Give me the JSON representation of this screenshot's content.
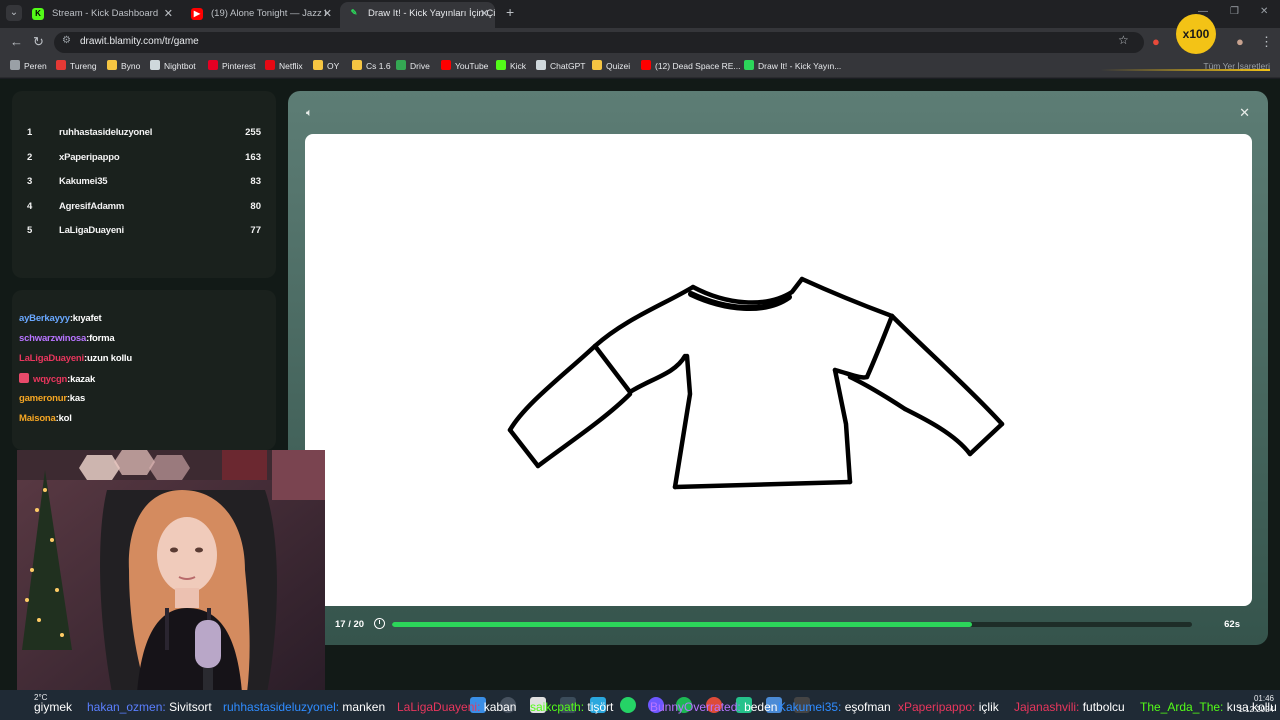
{
  "browser": {
    "tabs": [
      {
        "title": "Stream - Kick Dashboard",
        "icon": "kick-icon",
        "color": "#53fc18"
      },
      {
        "title": "(19) Alone Tonight — Jazz l",
        "icon": "youtube-icon",
        "color": "#ff0000"
      },
      {
        "title": "Draw It! - Kick Yayınları İçin Çiz",
        "icon": "drawit-icon",
        "color": "#2cd65a"
      }
    ],
    "url": "drawit.blamity.com/tr/game",
    "extension_badge": "x100",
    "bookmarks": [
      {
        "label": "Peren",
        "color": "#9aa0a6"
      },
      {
        "label": "Tureng",
        "color": "#e53935"
      },
      {
        "label": "Byno",
        "color": "#f5c542"
      },
      {
        "label": "Nightbot",
        "color": "#cfd8dc"
      },
      {
        "label": "Pinterest",
        "color": "#e60023"
      },
      {
        "label": "Netflix",
        "color": "#e50914"
      },
      {
        "label": "OY",
        "color": "#f5c542"
      },
      {
        "label": "Cs 1.6",
        "color": "#f5c542"
      },
      {
        "label": "Drive",
        "color": "#34a853"
      },
      {
        "label": "YouTube",
        "color": "#ff0000"
      },
      {
        "label": "Kick",
        "color": "#53fc18"
      },
      {
        "label": "ChatGPT",
        "color": "#cfd8dc"
      },
      {
        "label": "Quizei",
        "color": "#f5c542"
      },
      {
        "label": "(12) Dead Space RE...",
        "color": "#ff0000"
      },
      {
        "label": "Draw It! - Kick Yayın...",
        "color": "#2cd65a"
      }
    ],
    "bookmarks_all": "Tüm Yer İşaretleri"
  },
  "leaderboard": [
    {
      "rank": "1",
      "name": "ruhhastasideluzyonel",
      "score": "255"
    },
    {
      "rank": "2",
      "name": "xPaperipappo",
      "score": "163"
    },
    {
      "rank": "3",
      "name": "Kakumei35",
      "score": "83"
    },
    {
      "rank": "4",
      "name": "AgresifAdamm",
      "score": "80"
    },
    {
      "rank": "5",
      "name": "LaLigaDuayeni",
      "score": "77"
    }
  ],
  "chat": [
    {
      "user": "ayBerkayyy",
      "msg": "kıyafet",
      "color": "#6aa8ff",
      "badge": false
    },
    {
      "user": "schwarzwinosa",
      "msg": "forma",
      "color": "#b774ff",
      "badge": false
    },
    {
      "user": "LaLigaDuayeni",
      "msg": "uzun kollu",
      "color": "#e8365d",
      "badge": false
    },
    {
      "user": "wqycgn",
      "msg": "kazak",
      "color": "#e8365d",
      "badge": true
    },
    {
      "user": "gameronur",
      "msg": "kas",
      "color": "#f5a623",
      "badge": false
    },
    {
      "user": "Maisona",
      "msg": "kol",
      "color": "#f5a623",
      "badge": false
    }
  ],
  "game": {
    "round": "17 / 20",
    "time_left": "62s",
    "progress": 0.725
  },
  "ticker": [
    {
      "user": "",
      "msg": "giymek",
      "color": "#5a7fff"
    },
    {
      "user": "hakan_ozmen:",
      "msg": "Sivitsort",
      "color": "#5a7fff"
    },
    {
      "user": "ruhhastasideluzyonel:",
      "msg": "manken",
      "color": "#2f8cff"
    },
    {
      "user": "LaLigaDuayeni:",
      "msg": "kaban",
      "color": "#e8365d"
    },
    {
      "user": "saikcpath:",
      "msg": "tişört",
      "color": "#53fc18"
    },
    {
      "user": "BunnyOverrated:",
      "msg": "beden",
      "color": "#b774ff"
    },
    {
      "user": "Kakumei35:",
      "msg": "eşofman",
      "color": "#2f8cff"
    },
    {
      "user": "xPaperipappo:",
      "msg": "içlik",
      "color": "#e8365d"
    },
    {
      "user": "Jajanashvili:",
      "msg": "futbolcu",
      "color": "#e8365d"
    },
    {
      "user": "The_Arda_The:",
      "msg": "kısa kollu",
      "color": "#53fc18"
    }
  ],
  "taskbar": {
    "weather": "2°C",
    "time": "01:46",
    "date": "1.12.2024"
  }
}
